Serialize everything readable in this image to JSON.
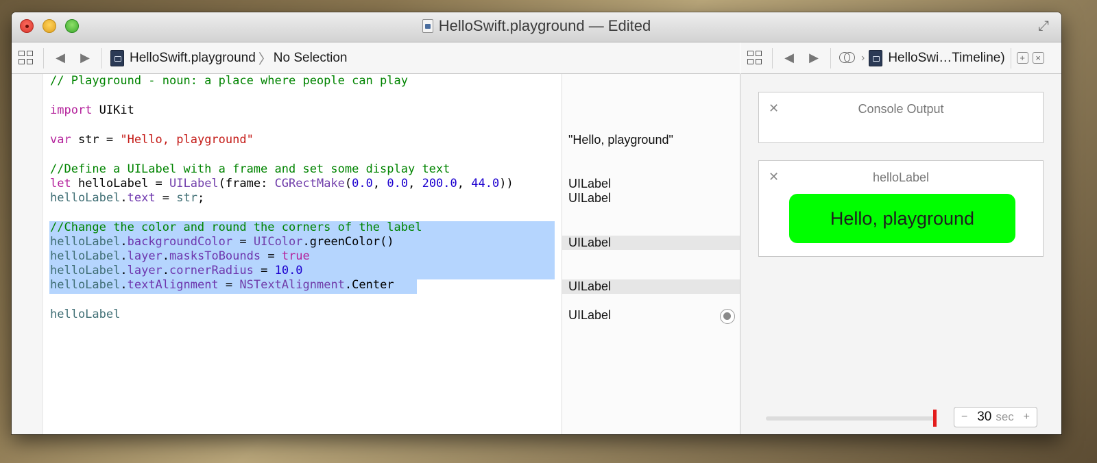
{
  "window": {
    "title": "HelloSwift.playground — Edited"
  },
  "toolbar_left": {
    "breadcrumb_file": "HelloSwift.playground",
    "breadcrumb_sep": "〉",
    "breadcrumb_selection": "No Selection"
  },
  "toolbar_right": {
    "breadcrumb_file": "HelloSwi…Timeline)",
    "breadcrumb_sep": "›"
  },
  "code": {
    "line1": "// Playground - noun: a place where people can play",
    "line3_kw": "import",
    "line3_rest": " UIKit",
    "line5_kw": "var",
    "line5_mid": " str = ",
    "line5_str": "\"Hello, playground\"",
    "line7": "//Define a UILabel with a frame and set some display text",
    "line8_kw": "let",
    "line8_a": " helloLabel = ",
    "line8_type": "UILabel",
    "line8_b": "(frame: ",
    "line8_fn": "CGRectMake",
    "line8_c": "(",
    "line8_n1": "0.0",
    "line8_comma1": ", ",
    "line8_n2": "0.0",
    "line8_comma2": ", ",
    "line8_n3": "200.0",
    "line8_comma3": ", ",
    "line8_n4": "44.0",
    "line8_d": "))",
    "line9_var": "helloLabel",
    "line9_dot": ".",
    "line9_mem": "text",
    "line9_eq": " = ",
    "line9_val": "str",
    "line9_end": ";",
    "line11": "//Change the color and round the corners of the label",
    "line12_var": "helloLabel",
    "line12_dot": ".",
    "line12_mem": "backgroundColor",
    "line12_eq": " = ",
    "line12_type": "UIColor",
    "line12_rest": ".greenColor()",
    "line13_var": "helloLabel",
    "line13_dot1": ".",
    "line13_mem1": "layer",
    "line13_dot2": ".",
    "line13_mem2": "masksToBounds",
    "line13_eq": " = ",
    "line13_kw": "true",
    "line14_var": "helloLabel",
    "line14_dot1": ".",
    "line14_mem1": "layer",
    "line14_dot2": ".",
    "line14_mem2": "cornerRadius",
    "line14_eq": " = ",
    "line14_num": "10.0",
    "line15_var": "helloLabel",
    "line15_dot": ".",
    "line15_mem": "textAlignment",
    "line15_eq": " = ",
    "line15_type": "NSTextAlignment",
    "line15_rest": ".Center",
    "line17_var": "helloLabel"
  },
  "results": {
    "r5": "\"Hello, playground\"",
    "r8": "UILabel",
    "r9": "UILabel",
    "r12": "UILabel",
    "r15": "UILabel",
    "r17": "UILabel"
  },
  "assistant": {
    "console_title": "Console Output",
    "label_panel_title": "helloLabel",
    "label_text": "Hello, playground",
    "label_color": "#00ff00",
    "timeline_value": "30",
    "timeline_unit": "sec",
    "minus": "−",
    "plus": "+"
  },
  "colors": {
    "comment": "#008400",
    "keyword": "#b4219b",
    "string": "#c41a16",
    "number": "#1c00cf",
    "selection": "#b5d5fe",
    "slider_thumb": "#e31c1c"
  }
}
